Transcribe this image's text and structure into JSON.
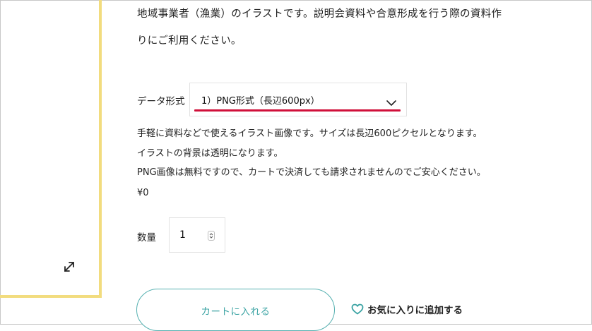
{
  "description": {
    "line1": "地域事業者（漁業）のイラストです。説明会資料や合意形成を行う際の資料作",
    "line2": "りにご利用ください。"
  },
  "format": {
    "label": "データ形式",
    "selected": "1）PNG形式（長辺600px）"
  },
  "info": {
    "line1": "手軽に資料などで使えるイラスト画像です。サイズは長辺600ピクセルとなります。",
    "line2": "イラストの背景は透明になります。",
    "line3": "PNG画像は無料ですので、カートで決済しても請求されませんのでご安心ください。"
  },
  "price": "¥0",
  "quantity": {
    "label": "数量",
    "value": "1"
  },
  "actions": {
    "cart_label": "カートに入れる",
    "favorite_label": "お気に入りに追加する"
  },
  "colors": {
    "accent_teal": "#3aa3a3",
    "highlight_red": "#d0103a",
    "gallery_border": "#f2dc7e"
  },
  "icons": {
    "expand": "expand-icon",
    "chevron": "chevron-down-icon",
    "heart": "heart-icon",
    "spinner": "spinner-icon"
  }
}
